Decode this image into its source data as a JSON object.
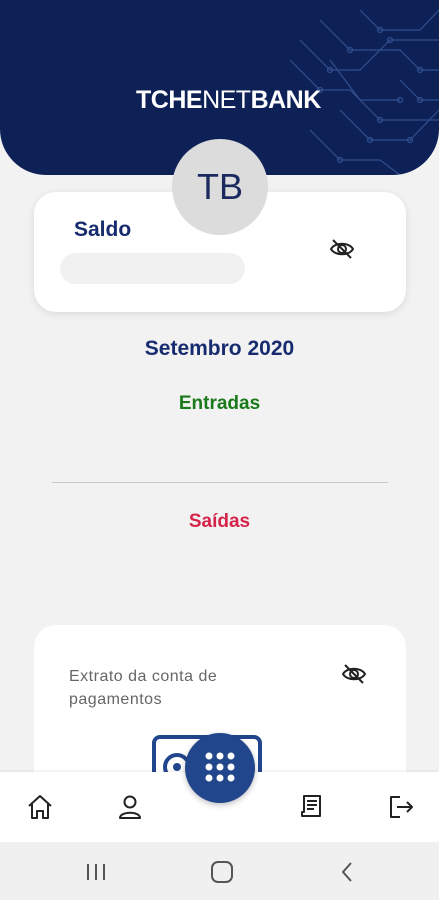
{
  "header": {
    "brand_left": "TCHE",
    "brand_mid": "NET",
    "brand_right": "BANK",
    "bg_color": "#0d2157"
  },
  "avatar": {
    "initials": "TB"
  },
  "balance_card": {
    "label": "Saldo",
    "toggle_icon": "eye-off-icon"
  },
  "summary": {
    "month": "Setembro 2020",
    "income_label": "Entradas",
    "expense_label": "Saídas",
    "income_color": "#1a7a1a",
    "expense_color": "#d6234a"
  },
  "statement_card": {
    "title": "Extrato da conta de pagamentos",
    "toggle_icon": "eye-off-icon"
  },
  "tabbar": {
    "items": [
      "home-icon",
      "user-icon",
      "keypad-icon",
      "receipt-icon",
      "logout-icon"
    ]
  },
  "system_nav": {
    "items": [
      "recents-icon",
      "home-circle-icon",
      "back-icon"
    ]
  }
}
